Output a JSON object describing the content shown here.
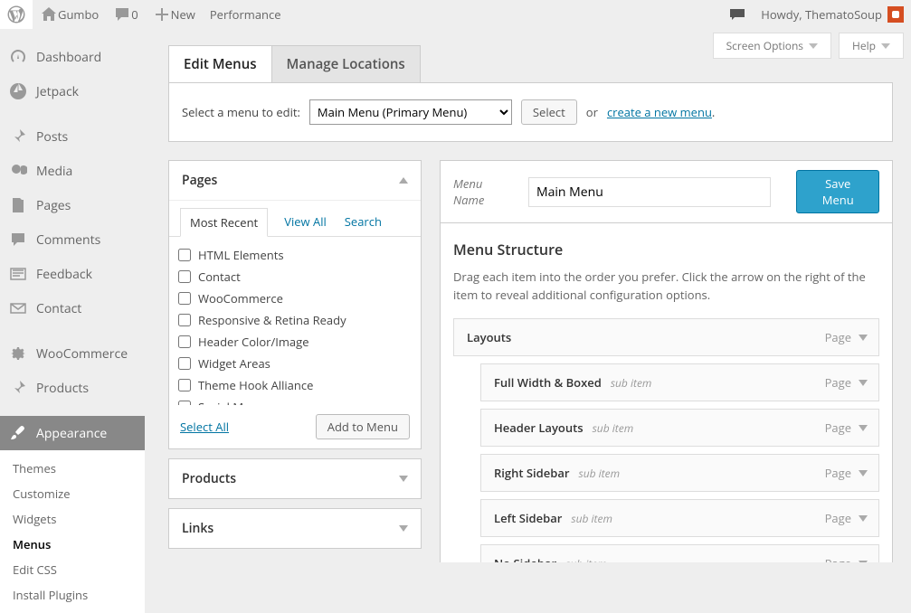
{
  "adminbar": {
    "site_name": "Gumbo",
    "comment_count": "0",
    "new_label": "New",
    "perf_label": "Performance",
    "howdy": "Howdy, ThematoSoup"
  },
  "topopts": {
    "screen_options": "Screen Options",
    "help": "Help"
  },
  "sidebar": {
    "items": [
      {
        "label": "Dashboard"
      },
      {
        "label": "Jetpack"
      },
      {
        "label": "Posts"
      },
      {
        "label": "Media"
      },
      {
        "label": "Pages"
      },
      {
        "label": "Comments"
      },
      {
        "label": "Feedback"
      },
      {
        "label": "Contact"
      },
      {
        "label": "WooCommerce"
      },
      {
        "label": "Products"
      },
      {
        "label": "Appearance"
      }
    ],
    "submenu": [
      {
        "label": "Themes"
      },
      {
        "label": "Customize"
      },
      {
        "label": "Widgets"
      },
      {
        "label": "Menus"
      },
      {
        "label": "Edit CSS"
      },
      {
        "label": "Install Plugins"
      }
    ]
  },
  "tabs": {
    "edit": "Edit Menus",
    "locations": "Manage Locations"
  },
  "selectbar": {
    "label": "Select a menu to edit:",
    "selected": "Main Menu (Primary Menu)",
    "button": "Select",
    "or": "or",
    "create_link": "create a new menu",
    "period": "."
  },
  "metaboxes": {
    "pages": {
      "title": "Pages",
      "tabs": {
        "recent": "Most Recent",
        "viewall": "View All",
        "search": "Search"
      },
      "items": [
        "HTML Elements",
        "Contact",
        "WooCommerce",
        "Responsive & Retina Ready",
        "Header Color/Image",
        "Widget Areas",
        "Theme Hook Alliance",
        "Social Menu"
      ],
      "select_all": "Select All",
      "add_btn": "Add to Menu"
    },
    "products": {
      "title": "Products"
    },
    "links": {
      "title": "Links"
    }
  },
  "menuname": {
    "label": "Menu Name",
    "value": "Main Menu",
    "save": "Save Menu"
  },
  "structure": {
    "heading": "Menu Structure",
    "desc": "Drag each item into the order you prefer. Click the arrow on the right of the item to reveal additional configuration options.",
    "items": [
      {
        "title": "Layouts",
        "sub": "",
        "type": "Page",
        "indent": false
      },
      {
        "title": "Full Width & Boxed",
        "sub": "sub item",
        "type": "Page",
        "indent": true
      },
      {
        "title": "Header Layouts",
        "sub": "sub item",
        "type": "Page",
        "indent": true
      },
      {
        "title": "Right Sidebar",
        "sub": "sub item",
        "type": "Page",
        "indent": true
      },
      {
        "title": "Left Sidebar",
        "sub": "sub item",
        "type": "Page",
        "indent": true
      },
      {
        "title": "No Sidebar",
        "sub": "sub item",
        "type": "Page",
        "indent": true
      }
    ]
  }
}
